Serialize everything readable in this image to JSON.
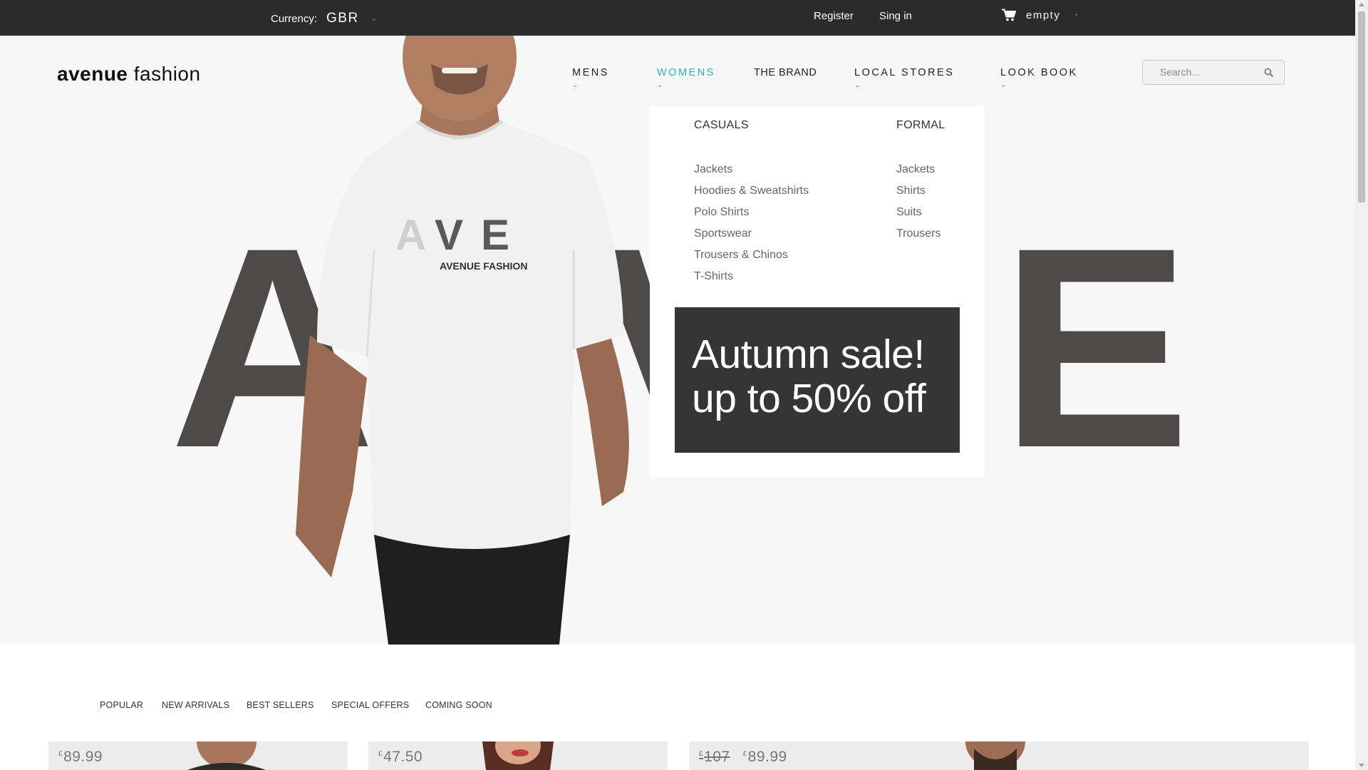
{
  "topbar": {
    "currency_label": "Currency:",
    "currency_value": "GBR",
    "register": "Register",
    "signin": "Sing in",
    "cart_status": "empty"
  },
  "header": {
    "logo_bold": "avenue",
    "logo_light": "fashion",
    "nav": {
      "mens": "MENS",
      "womens": "WOMENS",
      "brand": "THE BRAND",
      "stores": "LOCAL STORES",
      "lookbook": "LOOK BOOK"
    },
    "search_placeholder": "Search..."
  },
  "hero": {
    "letter_a": "A",
    "letter_v": "V",
    "letter_e": "E",
    "shirt_text": "AVENUE FASHION"
  },
  "mega_menu": {
    "casuals": {
      "heading": "CASUALS",
      "items": [
        "Jackets",
        "Hoodies & Sweatshirts",
        "Polo Shirts",
        "Sportswear",
        "Trousers & Chinos",
        "T-Shirts"
      ]
    },
    "formal": {
      "heading": "FORMAL",
      "items": [
        "Jackets",
        "Shirts",
        "Suits",
        "Trousers"
      ]
    },
    "promo": {
      "line1": "Autumn sale!",
      "line2": "up to 50% off"
    }
  },
  "tabs": [
    "POPULAR",
    "NEW ARRIVALS",
    "BEST SELLERS",
    "SPECIAL OFFERS",
    "COMING SOON"
  ],
  "products": [
    {
      "currency": "£",
      "price": "89.99"
    },
    {
      "currency": "£",
      "price": "47.50"
    },
    {
      "currency": "£",
      "old_price": "107",
      "price": "89.99"
    }
  ],
  "colors": {
    "accent": "#2bb0c4",
    "topbar": "#2b2b2b",
    "hero_letters": "#4e4a4a",
    "promo_bg": "#353535"
  }
}
